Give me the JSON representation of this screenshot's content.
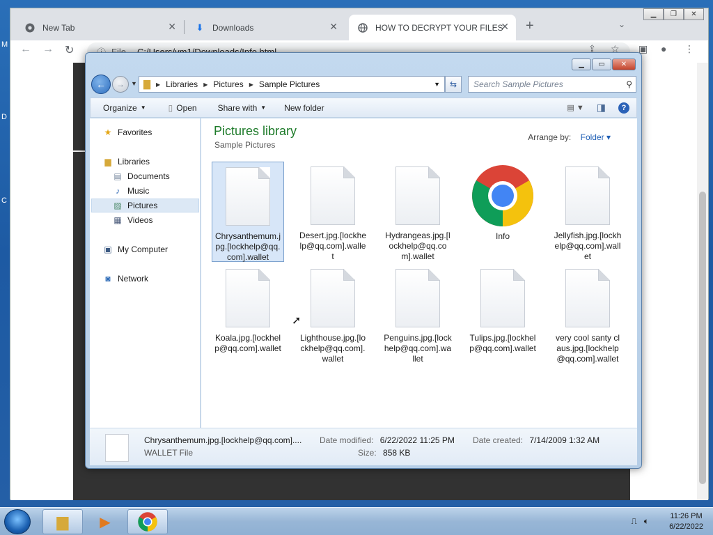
{
  "browser": {
    "tabs": [
      {
        "label": "New Tab",
        "icon": "chrome-icon",
        "active": false
      },
      {
        "label": "Downloads",
        "icon": "download-icon",
        "active": false
      },
      {
        "label": "HOW TO DECRYPT YOUR FILES",
        "icon": "globe-icon",
        "active": true
      }
    ],
    "address": {
      "scheme_label": "File",
      "url": "C:/Users/vm1/Downloads/Info.html"
    }
  },
  "explorer": {
    "breadcrumb": [
      "Libraries",
      "Pictures",
      "Sample Pictures"
    ],
    "search_placeholder": "Search Sample Pictures",
    "commands": {
      "organize": "Organize",
      "open": "Open",
      "share_with": "Share with",
      "new_folder": "New folder"
    },
    "nav": {
      "favorites": "Favorites",
      "libraries": "Libraries",
      "documents": "Documents",
      "music": "Music",
      "pictures": "Pictures",
      "videos": "Videos",
      "my_computer": "My Computer",
      "network": "Network"
    },
    "library_title": "Pictures library",
    "library_subtitle": "Sample Pictures",
    "arrange_label": "Arrange by:",
    "arrange_value": "Folder",
    "files": [
      {
        "name": "Chrysanthemum.jpg.[lockhelp@qq.com].wallet",
        "selected": true
      },
      {
        "name": "Desert.jpg.[lockhelp@qq.com].wallet"
      },
      {
        "name": "Hydrangeas.jpg.[lockhelp@qq.com].wallet"
      },
      {
        "name": "Info",
        "icon": "chrome-logo-icon"
      },
      {
        "name": "Jellyfish.jpg.[lockhelp@qq.com].wallet"
      },
      {
        "name": "Koala.jpg.[lockhelp@qq.com].wallet"
      },
      {
        "name": "Lighthouse.jpg.[lockhelp@qq.com].wallet"
      },
      {
        "name": "Penguins.jpg.[lockhelp@qq.com].wallet"
      },
      {
        "name": "Tulips.jpg.[lockhelp@qq.com].wallet"
      },
      {
        "name": "very cool santy claus.jpg.[lockhelp@qq.com].wallet"
      }
    ],
    "details": {
      "filename": "Chrysanthemum.jpg.[lockhelp@qq.com]....",
      "filetype": "WALLET File",
      "date_modified_label": "Date modified:",
      "date_modified": "6/22/2022 11:25 PM",
      "date_created_label": "Date created:",
      "date_created": "7/14/2009 1:32 AM",
      "size_label": "Size:",
      "size": "858 KB"
    }
  },
  "taskbar": {
    "time": "11:26 PM",
    "date": "6/22/2022"
  },
  "colors": {
    "library_title": "#1e7b2a",
    "link": "#1f5fb5",
    "selection": "#d7e6f8"
  }
}
